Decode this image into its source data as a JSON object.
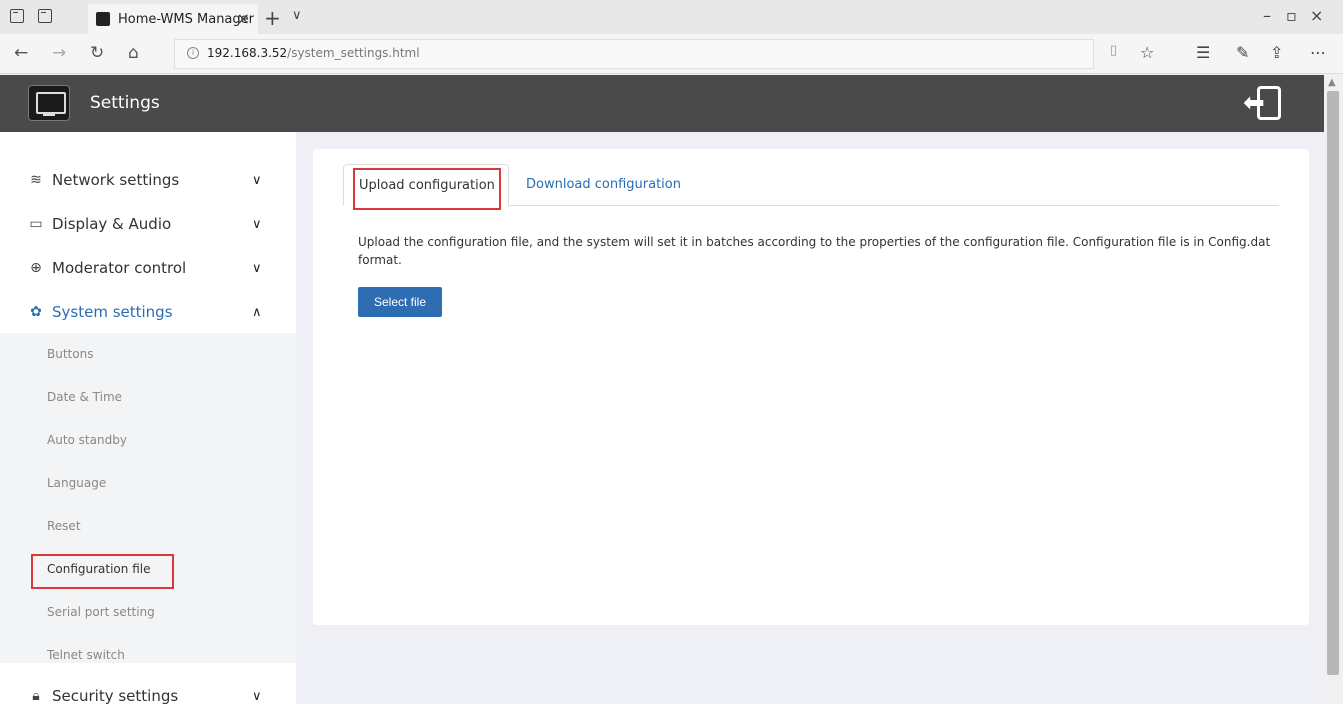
{
  "browser": {
    "tab_title": "Home-WMS Manager",
    "tab_close": "×",
    "new_tab": "+",
    "tab_menu": "∨",
    "url_host": "192.168.3.52",
    "url_path": "/system_settings.html",
    "window_controls": [
      "–",
      "▫",
      "×"
    ]
  },
  "header": {
    "title": "Settings"
  },
  "sidebar": {
    "items": [
      {
        "label": "Network settings",
        "icon": "wifi-icon",
        "chevron": "⌄"
      },
      {
        "label": "Display & Audio",
        "icon": "monitor-icon",
        "chevron": "⌄"
      },
      {
        "label": "Moderator control",
        "icon": "moderator-icon",
        "chevron": "⌄"
      },
      {
        "label": "System settings",
        "icon": "gear-icon",
        "chevron": "⌃"
      }
    ],
    "subitems": [
      "Buttons",
      "Date & Time",
      "Auto standby",
      "Language",
      "Reset",
      "Configuration file",
      "Serial port setting",
      "Telnet switch"
    ],
    "next_item": {
      "label": "Security settings",
      "icon": "lock-icon",
      "chevron": "⌄"
    }
  },
  "content": {
    "tabs": [
      "Upload configuration",
      "Download configuration"
    ],
    "description": "Upload the configuration file, and the system will set it in batches according to the properties of the configuration file. Configuration file is in Config.dat format.",
    "button": "Select file"
  },
  "colors": {
    "accent": "#2a6db4",
    "header_bg": "#4a4a4a",
    "highlight": "#d9383a"
  }
}
